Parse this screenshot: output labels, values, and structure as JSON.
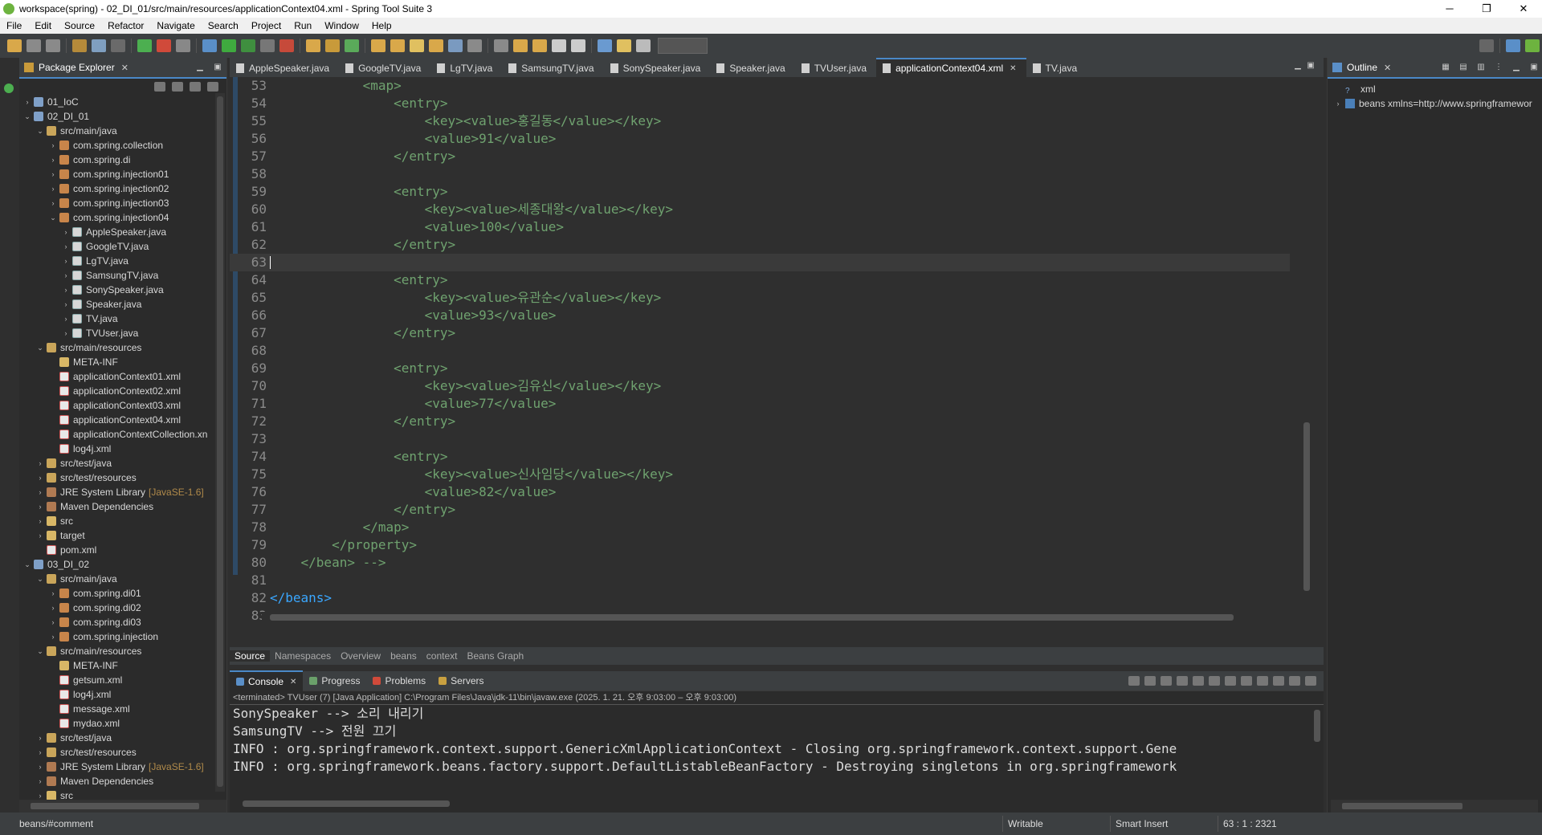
{
  "window": {
    "title": "workspace(spring) - 02_DI_01/src/main/resources/applicationContext04.xml - Spring Tool Suite 3",
    "minimize": "─",
    "maximize": "❐",
    "close": "✕"
  },
  "menu": [
    "File",
    "Edit",
    "Source",
    "Refactor",
    "Navigate",
    "Search",
    "Project",
    "Run",
    "Window",
    "Help"
  ],
  "package_explorer": {
    "title": "Package Explorer",
    "tree": [
      {
        "label": "01_IoC",
        "depth": 0,
        "expand": "›",
        "icon": "project"
      },
      {
        "label": "02_DI_01",
        "depth": 0,
        "expand": "⌄",
        "icon": "project"
      },
      {
        "label": "src/main/java",
        "depth": 1,
        "expand": "⌄",
        "icon": "srcfolder"
      },
      {
        "label": "com.spring.collection",
        "depth": 2,
        "expand": "›",
        "icon": "package"
      },
      {
        "label": "com.spring.di",
        "depth": 2,
        "expand": "›",
        "icon": "package"
      },
      {
        "label": "com.spring.injection01",
        "depth": 2,
        "expand": "›",
        "icon": "package"
      },
      {
        "label": "com.spring.injection02",
        "depth": 2,
        "expand": "›",
        "icon": "package"
      },
      {
        "label": "com.spring.injection03",
        "depth": 2,
        "expand": "›",
        "icon": "package"
      },
      {
        "label": "com.spring.injection04",
        "depth": 2,
        "expand": "⌄",
        "icon": "package"
      },
      {
        "label": "AppleSpeaker.java",
        "depth": 3,
        "expand": "›",
        "icon": "java"
      },
      {
        "label": "GoogleTV.java",
        "depth": 3,
        "expand": "›",
        "icon": "java"
      },
      {
        "label": "LgTV.java",
        "depth": 3,
        "expand": "›",
        "icon": "java"
      },
      {
        "label": "SamsungTV.java",
        "depth": 3,
        "expand": "›",
        "icon": "java"
      },
      {
        "label": "SonySpeaker.java",
        "depth": 3,
        "expand": "›",
        "icon": "java"
      },
      {
        "label": "Speaker.java",
        "depth": 3,
        "expand": "›",
        "icon": "java"
      },
      {
        "label": "TV.java",
        "depth": 3,
        "expand": "›",
        "icon": "java"
      },
      {
        "label": "TVUser.java",
        "depth": 3,
        "expand": "›",
        "icon": "java"
      },
      {
        "label": "src/main/resources",
        "depth": 1,
        "expand": "⌄",
        "icon": "srcfolder"
      },
      {
        "label": "META-INF",
        "depth": 2,
        "expand": "",
        "icon": "folder"
      },
      {
        "label": "applicationContext01.xml",
        "depth": 2,
        "expand": "",
        "icon": "xml"
      },
      {
        "label": "applicationContext02.xml",
        "depth": 2,
        "expand": "",
        "icon": "xml"
      },
      {
        "label": "applicationContext03.xml",
        "depth": 2,
        "expand": "",
        "icon": "xml"
      },
      {
        "label": "applicationContext04.xml",
        "depth": 2,
        "expand": "",
        "icon": "xml"
      },
      {
        "label": "applicationContextCollection.xn",
        "depth": 2,
        "expand": "",
        "icon": "xml"
      },
      {
        "label": "log4j.xml",
        "depth": 2,
        "expand": "",
        "icon": "xml"
      },
      {
        "label": "src/test/java",
        "depth": 1,
        "expand": "›",
        "icon": "srcfolder"
      },
      {
        "label": "src/test/resources",
        "depth": 1,
        "expand": "›",
        "icon": "srcfolder"
      },
      {
        "label": "JRE System Library",
        "suffix": "[JavaSE-1.6]",
        "depth": 1,
        "expand": "›",
        "icon": "lib"
      },
      {
        "label": "Maven Dependencies",
        "depth": 1,
        "expand": "›",
        "icon": "lib"
      },
      {
        "label": "src",
        "depth": 1,
        "expand": "›",
        "icon": "folder"
      },
      {
        "label": "target",
        "depth": 1,
        "expand": "›",
        "icon": "folder"
      },
      {
        "label": "pom.xml",
        "depth": 1,
        "expand": "",
        "icon": "xml"
      },
      {
        "label": "03_DI_02",
        "depth": 0,
        "expand": "⌄",
        "icon": "project"
      },
      {
        "label": "src/main/java",
        "depth": 1,
        "expand": "⌄",
        "icon": "srcfolder"
      },
      {
        "label": "com.spring.di01",
        "depth": 2,
        "expand": "›",
        "icon": "package"
      },
      {
        "label": "com.spring.di02",
        "depth": 2,
        "expand": "›",
        "icon": "package"
      },
      {
        "label": "com.spring.di03",
        "depth": 2,
        "expand": "›",
        "icon": "package"
      },
      {
        "label": "com.spring.injection",
        "depth": 2,
        "expand": "›",
        "icon": "package"
      },
      {
        "label": "src/main/resources",
        "depth": 1,
        "expand": "⌄",
        "icon": "srcfolder"
      },
      {
        "label": "META-INF",
        "depth": 2,
        "expand": "",
        "icon": "folder"
      },
      {
        "label": "getsum.xml",
        "depth": 2,
        "expand": "",
        "icon": "xml"
      },
      {
        "label": "log4j.xml",
        "depth": 2,
        "expand": "",
        "icon": "xml"
      },
      {
        "label": "message.xml",
        "depth": 2,
        "expand": "",
        "icon": "xml"
      },
      {
        "label": "mydao.xml",
        "depth": 2,
        "expand": "",
        "icon": "xml"
      },
      {
        "label": "src/test/java",
        "depth": 1,
        "expand": "›",
        "icon": "srcfolder"
      },
      {
        "label": "src/test/resources",
        "depth": 1,
        "expand": "›",
        "icon": "srcfolder"
      },
      {
        "label": "JRE System Library",
        "suffix": "[JavaSE-1.6]",
        "depth": 1,
        "expand": "›",
        "icon": "lib"
      },
      {
        "label": "Maven Dependencies",
        "depth": 1,
        "expand": "›",
        "icon": "lib"
      },
      {
        "label": "src",
        "depth": 1,
        "expand": "›",
        "icon": "folder"
      }
    ]
  },
  "editor": {
    "tabs": [
      {
        "label": "AppleSpeaker.java",
        "active": false
      },
      {
        "label": "GoogleTV.java",
        "active": false
      },
      {
        "label": "LgTV.java",
        "active": false
      },
      {
        "label": "SamsungTV.java",
        "active": false
      },
      {
        "label": "SonySpeaker.java",
        "active": false
      },
      {
        "label": "Speaker.java",
        "active": false
      },
      {
        "label": "TVUser.java",
        "active": false
      },
      {
        "label": "applicationContext04.xml",
        "active": true
      },
      {
        "label": "TV.java",
        "active": false
      }
    ],
    "lines": [
      {
        "n": "53",
        "text": "            <map>"
      },
      {
        "n": "54",
        "text": "                <entry>"
      },
      {
        "n": "55",
        "text": "                    <key><value>홍길동</value></key>"
      },
      {
        "n": "56",
        "text": "                    <value>91</value>"
      },
      {
        "n": "57",
        "text": "                </entry>"
      },
      {
        "n": "58",
        "text": ""
      },
      {
        "n": "59",
        "text": "                <entry>"
      },
      {
        "n": "60",
        "text": "                    <key><value>세종대왕</value></key>"
      },
      {
        "n": "61",
        "text": "                    <value>100</value>"
      },
      {
        "n": "62",
        "text": "                </entry>"
      },
      {
        "n": "63",
        "text": ""
      },
      {
        "n": "64",
        "text": "                <entry>"
      },
      {
        "n": "65",
        "text": "                    <key><value>유관순</value></key>"
      },
      {
        "n": "66",
        "text": "                    <value>93</value>"
      },
      {
        "n": "67",
        "text": "                </entry>"
      },
      {
        "n": "68",
        "text": ""
      },
      {
        "n": "69",
        "text": "                <entry>"
      },
      {
        "n": "70",
        "text": "                    <key><value>김유신</value></key>"
      },
      {
        "n": "71",
        "text": "                    <value>77</value>"
      },
      {
        "n": "72",
        "text": "                </entry>"
      },
      {
        "n": "73",
        "text": ""
      },
      {
        "n": "74",
        "text": "                <entry>"
      },
      {
        "n": "75",
        "text": "                    <key><value>신사임당</value></key>"
      },
      {
        "n": "76",
        "text": "                    <value>82</value>"
      },
      {
        "n": "77",
        "text": "                </entry>"
      },
      {
        "n": "78",
        "text": "            </map>"
      },
      {
        "n": "79",
        "text": "        </property>"
      },
      {
        "n": "80",
        "text": "    </bean> -->"
      },
      {
        "n": "81",
        "text": ""
      },
      {
        "n": "82",
        "text": "</beans>"
      },
      {
        "n": "83",
        "text": ""
      }
    ],
    "current_line": "63",
    "page_tabs": [
      "Source",
      "Namespaces",
      "Overview",
      "beans",
      "context",
      "Beans Graph"
    ]
  },
  "outline": {
    "title": "Outline",
    "items": [
      {
        "label": "xml",
        "expand": "",
        "icon": "pi"
      },
      {
        "label": "beans xmlns=http://www.springframewor",
        "expand": "›",
        "icon": "element"
      }
    ]
  },
  "console": {
    "tabs": [
      {
        "label": "Console",
        "active": true
      },
      {
        "label": "Progress",
        "active": false
      },
      {
        "label": "Problems",
        "active": false
      },
      {
        "label": "Servers",
        "active": false
      }
    ],
    "description": "<terminated> TVUser (7) [Java Application] C:\\Program Files\\Java\\jdk-11\\bin\\javaw.exe  (2025. 1. 21. 오후 9:03:00 – 오후 9:03:00)",
    "lines": [
      "SonySpeaker --> 소리 내리기",
      "SamsungTV --> 전원 끄기",
      "INFO : org.springframework.context.support.GenericXmlApplicationContext - Closing org.springframework.context.support.Gene",
      "INFO : org.springframework.beans.factory.support.DefaultListableBeanFactory - Destroying singletons in org.springframework"
    ]
  },
  "status": {
    "selection": "beans/#comment",
    "writable": "Writable",
    "insert_mode": "Smart Insert",
    "position": "63 : 1 : 2321"
  },
  "colors": {
    "accent": "#4a88c7",
    "xml_tag": "#6fa26f",
    "keyword": "#3aa7ff"
  }
}
